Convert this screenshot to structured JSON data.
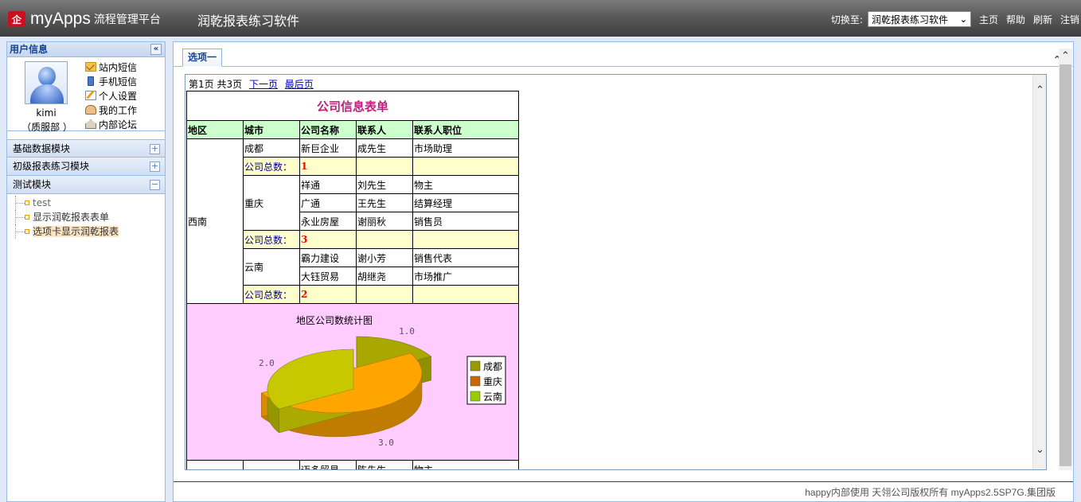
{
  "header": {
    "logo_mark": "企",
    "brand": "myApps",
    "subtitle": "流程管理平台",
    "app_title": "润乾报表练习软件",
    "switch_label": "切换至:",
    "switch_value": "润乾报表练习软件",
    "links": [
      "主页",
      "帮助",
      "刷新",
      "注销"
    ]
  },
  "sidebar": {
    "user_title": "用户信息",
    "user_name": "kimi",
    "user_dept": "（质服部 ）",
    "user_links": [
      "站内短信",
      "手机短信",
      "个人设置",
      "我的工作",
      "内部论坛"
    ],
    "modules": [
      {
        "label": "基础数据模块",
        "toggle": "+"
      },
      {
        "label": "初级报表练习模块",
        "toggle": "+"
      },
      {
        "label": "测试模块",
        "toggle": "−"
      }
    ],
    "tree": [
      "test",
      "显示润乾报表表单",
      "选项卡显示润乾报表"
    ]
  },
  "main": {
    "tab_label": "选项一",
    "pager": {
      "page": "第1页",
      "total": "共3页",
      "next": "下一页",
      "last": "最后页"
    },
    "report": {
      "title": "公司信息表单",
      "headers": [
        "地区",
        "城市",
        "公司名称",
        "联系人",
        "联系人职位"
      ],
      "region": "西南",
      "sum_label": "公司总数：",
      "cities": [
        {
          "name": "成都",
          "rows": [
            [
              "新巨企业",
              "成先生",
              "市场助理"
            ]
          ],
          "count": "1"
        },
        {
          "name": "重庆",
          "rows": [
            [
              "祥通",
              "刘先生",
              "物主"
            ],
            [
              "广通",
              "王先生",
              "结算经理"
            ],
            [
              "永业房屋",
              "谢丽秋",
              "销售员"
            ]
          ],
          "count": "3"
        },
        {
          "name": "云南",
          "rows": [
            [
              "霸力建设",
              "谢小芳",
              "销售代表"
            ],
            [
              "大钰贸易",
              "胡继尧",
              "市场推广"
            ]
          ],
          "count": "2"
        }
      ],
      "next_row": [
        "迈多贸易",
        "陈先生",
        "物主"
      ]
    },
    "footer": "happy内部使用 天翎公司版权所有 myApps2.5SP7G.集团版"
  },
  "chart_data": {
    "type": "pie",
    "title": "地区公司数统计图",
    "categories": [
      "成都",
      "重庆",
      "云南"
    ],
    "values": [
      1,
      3,
      2
    ],
    "value_labels": [
      "1.0",
      "3.0",
      "2.0"
    ],
    "colors": [
      "#a8a800",
      "#ffa500",
      "#c8c800"
    ],
    "legend_colors": [
      "#999900",
      "#cc6600",
      "#99cc00"
    ],
    "legend": "right"
  }
}
